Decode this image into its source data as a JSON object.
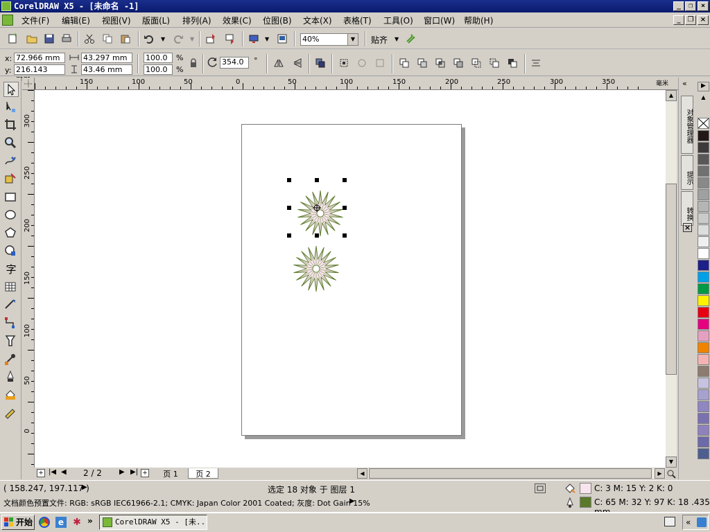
{
  "window": {
    "title": "CorelDRAW X5 - [未命名 -1]"
  },
  "menu": [
    "文件(F)",
    "编辑(E)",
    "视图(V)",
    "版面(L)",
    "排列(A)",
    "效果(C)",
    "位图(B)",
    "文本(X)",
    "表格(T)",
    "工具(O)",
    "窗口(W)",
    "帮助(H)"
  ],
  "toolbar": {
    "zoom": "40%",
    "snap_label": "贴齐"
  },
  "props": {
    "x_label": "x:",
    "y_label": "y:",
    "x": "72.966 mm",
    "y": "216.143 mm",
    "w": "43.297 mm",
    "h": "43.46 mm",
    "sx": "100.0",
    "sy": "100.0",
    "pct": "%",
    "angle": "354.0",
    "deg": "°"
  },
  "ruler": {
    "unit": "毫米",
    "h_ticks": [
      "150",
      "100",
      "50",
      "0",
      "50",
      "100",
      "150",
      "200",
      "250",
      "300",
      "350"
    ],
    "v_ticks": [
      "300",
      "250",
      "200",
      "150",
      "100",
      "50",
      "0"
    ]
  },
  "pagenav": {
    "counter": "2 / 2",
    "tabs": [
      "页 1",
      "页 2"
    ],
    "active": 1
  },
  "docker": {
    "tabs": [
      "对象管理器",
      "提示",
      "转换"
    ]
  },
  "palette": [
    "#231815",
    "#3e3a39",
    "#595757",
    "#727171",
    "#898989",
    "#9fa0a0",
    "#b5b5b6",
    "#c9caca",
    "#dcdddd",
    "#efefef",
    "#ffffff",
    "#1d2088",
    "#00a0e9",
    "#009944",
    "#fff100",
    "#e60012",
    "#e4007f",
    "#e5a0c0",
    "#f08300",
    "#f5b2b2",
    "#8c7b6f",
    "#c6c3e0",
    "#a6a1cf",
    "#8e87c0",
    "#7a71b0",
    "#8f82bc",
    "#6c6aa8",
    "#4c5f8e"
  ],
  "status": {
    "coords": "( 158.247, 197.117 )",
    "selection": "选定 18 对象 于 图层 1",
    "fill": "C: 3 M: 15 Y: 2 K: 0",
    "outline": "C: 65 M: 32 Y: 97 K: 18  .435 mm",
    "fill_color": "#f7e4ec",
    "outline_color": "#5a7a2a",
    "profile": "文档颜色预置文件: RGB: sRGB IEC61966-2.1; CMYK: Japan Color 2001 Coated; 灰度: Dot Gain 15%"
  },
  "taskbar": {
    "start": "开始",
    "task": "CorelDRAW X5 - [未..."
  }
}
